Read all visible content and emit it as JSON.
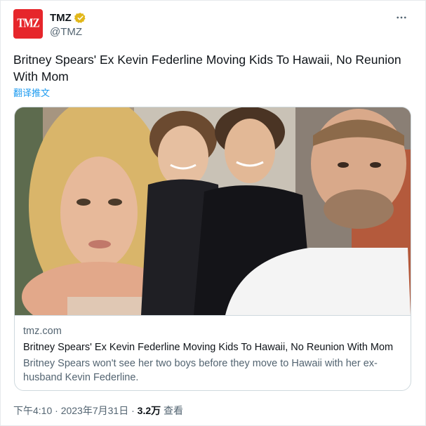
{
  "author": {
    "display_name": "TMZ",
    "handle": "@TMZ",
    "avatar_text": "TMZ",
    "verified_color": "#e2b719",
    "avatar_color": "#e6262b"
  },
  "tweet": {
    "text": "Britney Spears' Ex Kevin Federline Moving Kids To Hawaii, No Reunion With Mom",
    "translate_label": "翻译推文"
  },
  "card": {
    "domain": "tmz.com",
    "title": "Britney Spears' Ex Kevin Federline Moving Kids To Hawaii, No Reunion With Mom",
    "description": "Britney Spears won't see her two boys before they move to Hawaii with her ex-husband Kevin Federline."
  },
  "meta": {
    "time": "下午4:10",
    "separator1": "·",
    "date": "2023年7月31日",
    "separator2": "·",
    "views_count": "3.2万",
    "views_label": "查看"
  },
  "colors": {
    "link": "#1d9bf0",
    "secondary_text": "#536471",
    "primary_text": "#0f1419"
  },
  "icons": {
    "more": "more-horizontal-icon",
    "verified": "verified-badge-icon"
  }
}
